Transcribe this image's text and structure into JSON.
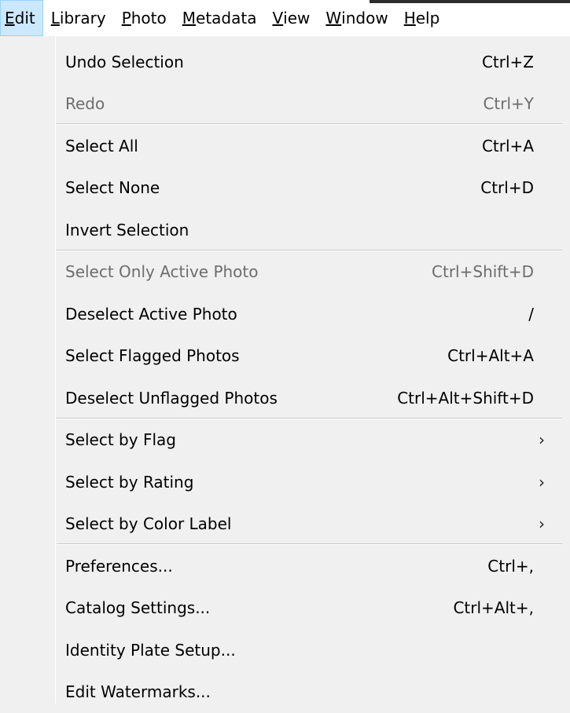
{
  "menubar": {
    "items": [
      {
        "accel": "E",
        "rest": "dit",
        "active": true
      },
      {
        "accel": "L",
        "rest": "ibrary",
        "active": false
      },
      {
        "accel": "P",
        "rest": "hoto",
        "active": false
      },
      {
        "accel": "M",
        "rest": "etadata",
        "active": false
      },
      {
        "accel": "V",
        "rest": "iew",
        "active": false
      },
      {
        "accel": "W",
        "rest": "indow",
        "active": false
      },
      {
        "accel": "H",
        "rest": "elp",
        "active": false
      }
    ]
  },
  "edit_menu": {
    "groups": [
      [
        {
          "label": "Undo Selection",
          "shortcut": "Ctrl+Z",
          "enabled": true
        },
        {
          "label": "Redo",
          "shortcut": "Ctrl+Y",
          "enabled": false
        }
      ],
      [
        {
          "label": "Select All",
          "shortcut": "Ctrl+A",
          "enabled": true
        },
        {
          "label": "Select None",
          "shortcut": "Ctrl+D",
          "enabled": true
        },
        {
          "label": "Invert Selection",
          "shortcut": "",
          "enabled": true
        }
      ],
      [
        {
          "label": "Select Only Active Photo",
          "shortcut": "Ctrl+Shift+D",
          "enabled": false
        },
        {
          "label": "Deselect Active Photo",
          "shortcut": "/",
          "enabled": true
        },
        {
          "label": "Select Flagged Photos",
          "shortcut": "Ctrl+Alt+A",
          "enabled": true
        },
        {
          "label": "Deselect Unflagged Photos",
          "shortcut": "Ctrl+Alt+Shift+D",
          "enabled": true
        }
      ],
      [
        {
          "label": "Select by Flag",
          "submenu": true,
          "enabled": true
        },
        {
          "label": "Select by Rating",
          "submenu": true,
          "enabled": true
        },
        {
          "label": "Select by Color Label",
          "submenu": true,
          "enabled": true
        }
      ],
      [
        {
          "label": "Preferences...",
          "shortcut": "Ctrl+,",
          "enabled": true
        },
        {
          "label": "Catalog Settings...",
          "shortcut": "Ctrl+Alt+,",
          "enabled": true
        },
        {
          "label": "Identity Plate Setup...",
          "shortcut": "",
          "enabled": true
        },
        {
          "label": "Edit Watermarks...",
          "shortcut": "",
          "enabled": true
        }
      ]
    ],
    "submenu_arrow_glyph": "›"
  }
}
